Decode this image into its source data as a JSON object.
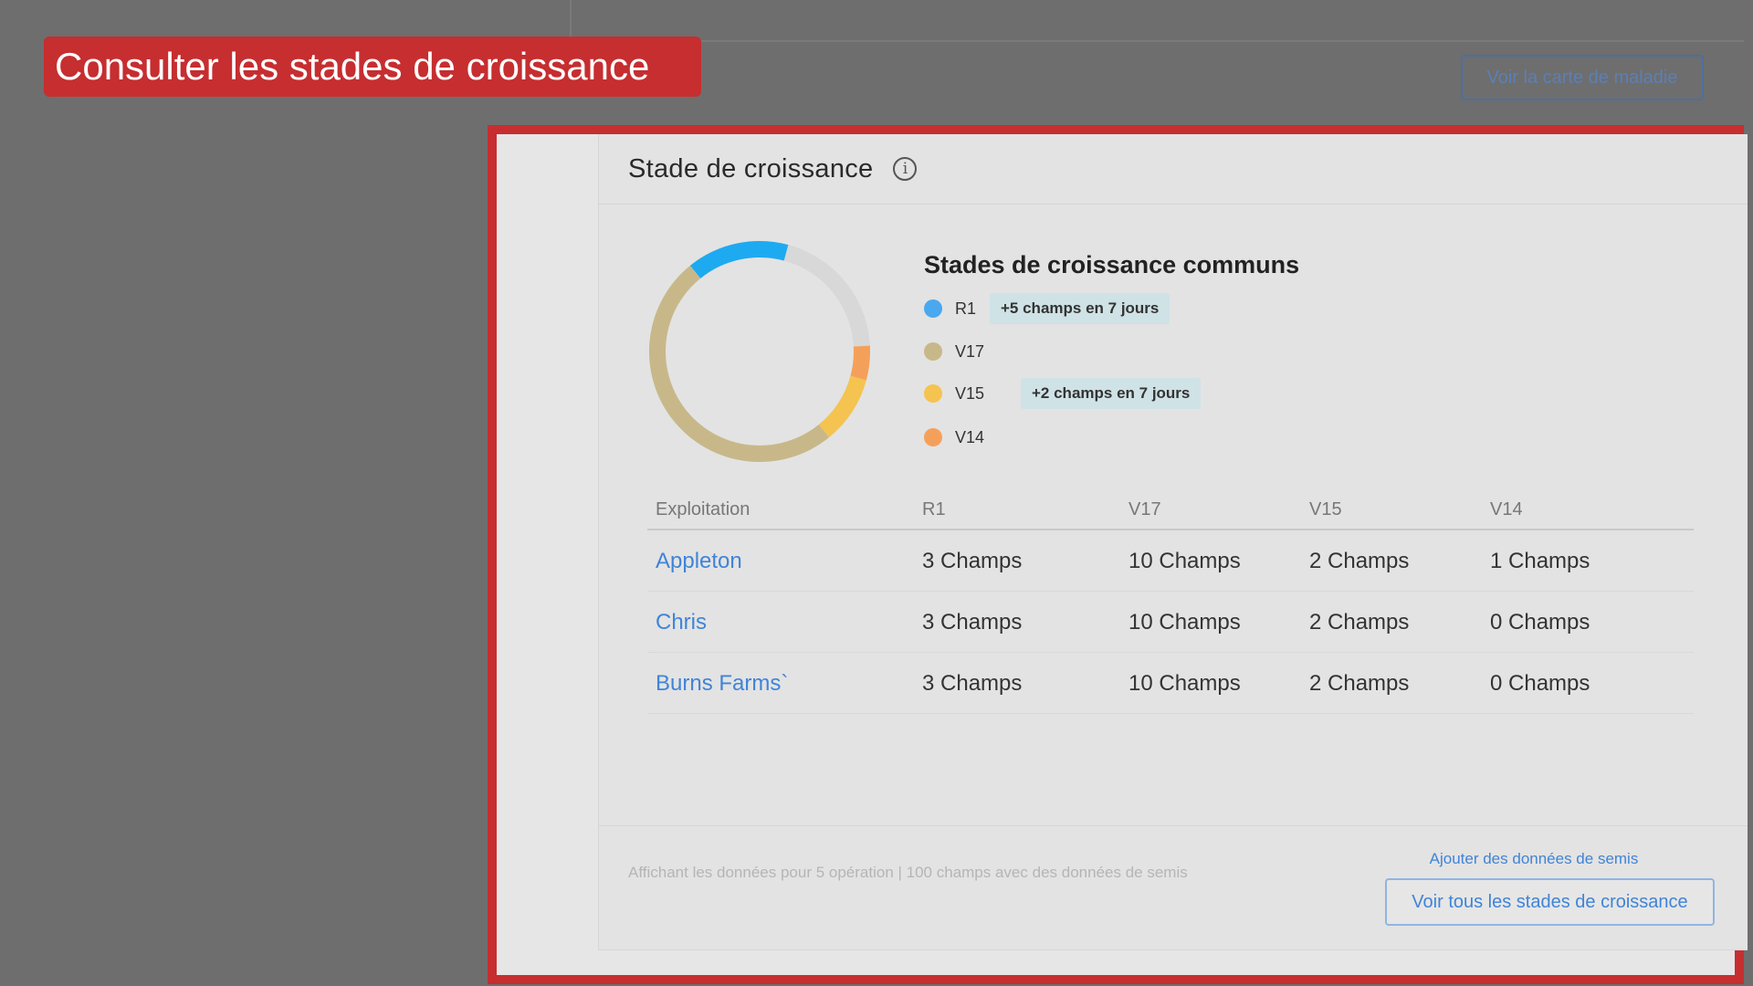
{
  "callout": {
    "text": "Consulter les stades de croissance"
  },
  "top_button": {
    "label": "Voir la carte de maladie"
  },
  "card": {
    "title": "Stade de croissance",
    "info_icon": "info-icon",
    "legend_title": "Stades de croissance communs",
    "stages": [
      {
        "label": "R1",
        "color": "#4aa8ee",
        "badge": "+5 champs en 7 jours"
      },
      {
        "label": "V17",
        "color": "#c8b889",
        "badge": ""
      },
      {
        "label": "V15",
        "color": "#f5c350",
        "badge": "+2 champs en 7 jours"
      },
      {
        "label": "V14",
        "color": "#f5a05a",
        "badge": ""
      }
    ],
    "table": {
      "headers": [
        "Exploitation",
        "R1",
        "V17",
        "V15",
        "V14"
      ],
      "rows": [
        {
          "farm": "Appleton",
          "cells": [
            "3 Champs",
            "10 Champs",
            "2 Champs",
            "1 Champs"
          ]
        },
        {
          "farm": "Chris",
          "cells": [
            "3 Champs",
            "10 Champs",
            "2 Champs",
            "0 Champs"
          ]
        },
        {
          "farm": "Burns Farms`",
          "cells": [
            "3 Champs",
            "10 Champs",
            "2 Champs",
            "0 Champs"
          ]
        }
      ]
    },
    "footer_note": "Affichant les données pour 5 opération | 100 champs avec des données de semis",
    "footer_link": "Ajouter des données de semis",
    "footer_button": "Voir tous les stades de croissance"
  },
  "chart_data": {
    "type": "pie",
    "style": "donut",
    "slices": [
      {
        "label": "R1",
        "value": 3,
        "color": "#1eaaf0"
      },
      {
        "label": "V17",
        "value": 10,
        "color": "#c8b889"
      },
      {
        "label": "V15",
        "value": 2,
        "color": "#f5c350"
      },
      {
        "label": "V14",
        "value": 1,
        "color": "#f5a05a"
      }
    ]
  }
}
